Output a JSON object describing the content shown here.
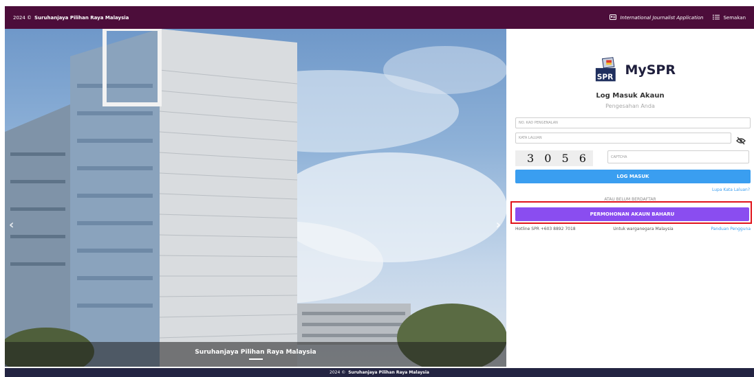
{
  "topbar": {
    "copyright": "2024 ©",
    "org": "Suruhanjaya Pilihan Raya Malaysia",
    "journalist_link": "International Journalist Application",
    "semakan_link": "Semakan"
  },
  "hero": {
    "caption": "Suruhanjaya Pilihan Raya Malaysia"
  },
  "login": {
    "brand": "MySPR",
    "heading": "Log Masuk Akaun",
    "subheading": "Pengesahan Anda",
    "nric_placeholder": "NO. KAD PENGENALAN",
    "password_placeholder": "KATA LALUAN",
    "captcha_image_text": "3056",
    "captcha_placeholder": "CAPTCHA",
    "login_button": "LOG MASUK",
    "forgot_link": "Lupa Kata Laluan?",
    "or_text": "ATAU BELUM BERDAFTAR",
    "register_button": "PERMOHONAN AKAUN BAHARU",
    "hotline": "Hotline SPR +603 8892 7018",
    "citizens_note": "Untuk warganegara Malaysia",
    "guide_link": "Panduan Pengguna"
  },
  "footer": {
    "copyright": "2024 ©",
    "org": "Suruhanjaya Pilihan Raya Malaysia"
  },
  "icons": {
    "journalist": "id-card-icon",
    "semakan": "list-icon",
    "password_toggle": "eye-slash-icon",
    "carousel_prev": "chevron-left-icon",
    "carousel_next": "chevron-right-icon"
  },
  "colors": {
    "topbar": "#4c0d3a",
    "footer": "#232442",
    "login_button": "#3a9ef0",
    "register_button": "#8a4df0",
    "highlight": "#e0121a"
  }
}
